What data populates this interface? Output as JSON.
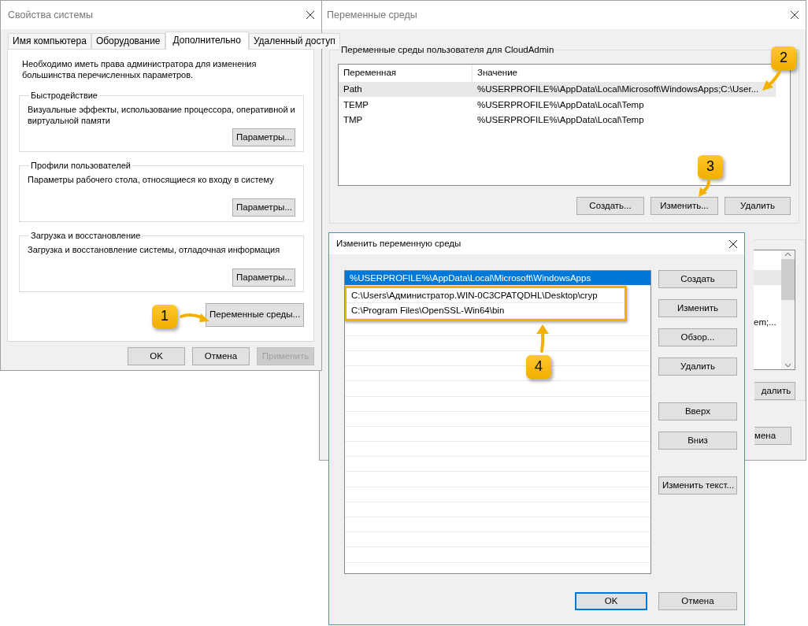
{
  "system_properties": {
    "title": "Свойства системы",
    "tabs": [
      {
        "label": "Имя компьютера",
        "selected": false
      },
      {
        "label": "Оборудование",
        "selected": false
      },
      {
        "label": "Дополнительно",
        "selected": true
      },
      {
        "label": "Удаленный доступ",
        "selected": false
      }
    ],
    "intro": "Необходимо иметь права администратора для изменения большинства перечисленных параметров.",
    "groups": [
      {
        "legend": "Быстродействие",
        "text": "Визуальные эффекты, использование процессора, оперативной и виртуальной памяти",
        "button": "Параметры..."
      },
      {
        "legend": "Профили пользователей",
        "text": "Параметры рабочего стола, относящиеся ко входу в систему",
        "button": "Параметры..."
      },
      {
        "legend": "Загрузка и восстановление",
        "text": "Загрузка и восстановление системы, отладочная информация",
        "button": "Параметры..."
      }
    ],
    "env_button": "Переменные среды...",
    "buttons": [
      {
        "label": "OK",
        "disabled": false
      },
      {
        "label": "Отмена",
        "disabled": false
      },
      {
        "label": "Применить",
        "disabled": true
      }
    ]
  },
  "environment_variables": {
    "title": "Переменные среды",
    "user_group": {
      "legend": "Переменные среды пользователя для CloudAdmin",
      "columns": [
        "Переменная",
        "Значение"
      ],
      "rows": [
        {
          "name": "Path",
          "value": "%USERPROFILE%\\AppData\\Local\\Microsoft\\WindowsApps;C:\\User...",
          "selected": true
        },
        {
          "name": "TEMP",
          "value": "%USERPROFILE%\\AppData\\Local\\Temp",
          "selected": false
        },
        {
          "name": "TMP",
          "value": "%USERPROFILE%\\AppData\\Local\\Temp",
          "selected": false
        }
      ],
      "buttons": [
        "Создать...",
        "Изменить...",
        "Удалить"
      ]
    },
    "system_group": {
      "visible_text": "em;...",
      "buttons": [
        "далить",
        "мена"
      ]
    }
  },
  "edit_dialog": {
    "title": "Изменить переменную среды",
    "entries": [
      {
        "text": "%USERPROFILE%\\AppData\\Local\\Microsoft\\WindowsApps",
        "selected": true,
        "highlighted": false
      },
      {
        "text": "C:\\Users\\Администратор.WIN-0C3CPATQDHL\\Desktop\\cryp",
        "selected": false,
        "highlighted": true
      },
      {
        "text": "C:\\Program Files\\OpenSSL-Win64\\bin",
        "selected": false,
        "highlighted": true
      }
    ],
    "side_button_groups": [
      [
        "Создать",
        "Изменить",
        "Обзор...",
        "Удалить"
      ],
      [
        "Вверх",
        "Вниз"
      ],
      [
        "Изменить текст..."
      ]
    ],
    "buttons": [
      {
        "label": "OK",
        "default": true
      },
      {
        "label": "Отмена",
        "default": false
      }
    ]
  },
  "callouts": [
    {
      "label": "1"
    },
    {
      "label": "2"
    },
    {
      "label": "3"
    },
    {
      "label": "4"
    }
  ]
}
